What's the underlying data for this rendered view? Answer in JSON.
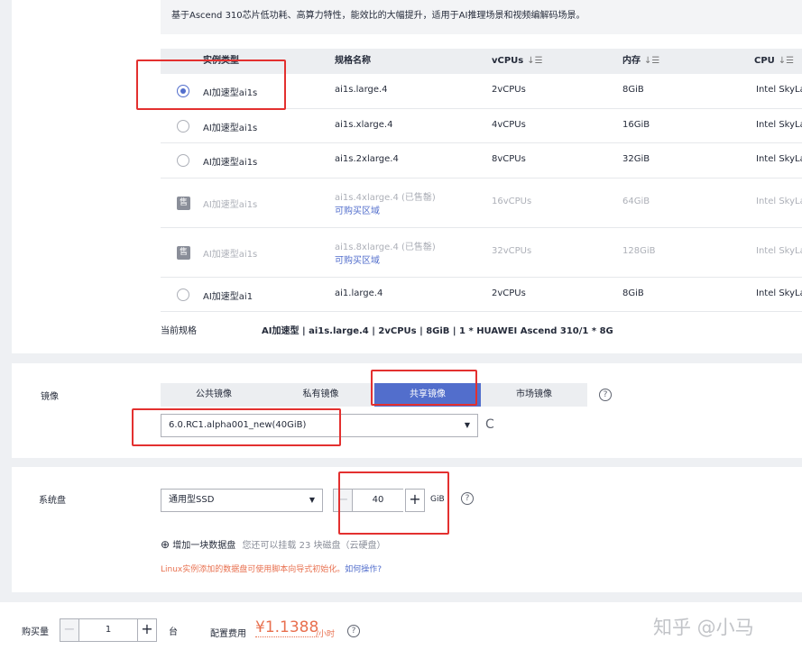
{
  "description": "基于Ascend 310芯片低功耗、高算力特性，能效比的大幅提升，适用于AI推理场景和视频编解码场景。",
  "table": {
    "headers": {
      "type": "实例类型",
      "spec": "规格名称",
      "vcpus": "vCPUs",
      "memory": "内存",
      "cpu": "CPU"
    },
    "sort_icon": "↓☰",
    "rows": [
      {
        "state": "selected",
        "type": "AI加速型ai1s",
        "spec": "ai1s.large.4",
        "spec_note": "",
        "vcpus": "2vCPUs",
        "memory": "8GiB",
        "cpu": "Intel SkyLa"
      },
      {
        "state": "normal",
        "type": "AI加速型ai1s",
        "spec": "ai1s.xlarge.4",
        "spec_note": "",
        "vcpus": "4vCPUs",
        "memory": "16GiB",
        "cpu": "Intel SkyLa"
      },
      {
        "state": "normal",
        "type": "AI加速型ai1s",
        "spec": "ai1s.2xlarge.4",
        "spec_note": "",
        "vcpus": "8vCPUs",
        "memory": "32GiB",
        "cpu": "Intel SkyLa"
      },
      {
        "state": "soldout",
        "type": "AI加速型ai1s",
        "spec": "ai1s.4xlarge.4 (已售罄)",
        "spec_note": "可购买区域",
        "vcpus": "16vCPUs",
        "memory": "64GiB",
        "cpu": "Intel SkyLa"
      },
      {
        "state": "soldout",
        "type": "AI加速型ai1s",
        "spec": "ai1s.8xlarge.4 (已售罄)",
        "spec_note": "可购买区域",
        "vcpus": "32vCPUs",
        "memory": "128GiB",
        "cpu": "Intel SkyLa"
      },
      {
        "state": "normal",
        "type": "AI加速型ai1",
        "spec": "ai1.large.4",
        "spec_note": "",
        "vcpus": "2vCPUs",
        "memory": "8GiB",
        "cpu": "Intel SkyLa"
      }
    ],
    "soldout_glyph": "售"
  },
  "current_spec": {
    "label": "当前规格",
    "value": "AI加速型 | ai1s.large.4 | 2vCPUs | 8GiB | 1 * HUAWEI Ascend 310/1 * 8G"
  },
  "image": {
    "label": "镜像",
    "tabs": [
      {
        "label": "公共镜像",
        "active": false
      },
      {
        "label": "私有镜像",
        "active": false
      },
      {
        "label": "共享镜像",
        "active": true
      },
      {
        "label": "市场镜像",
        "active": false
      }
    ],
    "selected_image": "6.0.RC1.alpha001_new(40GiB)",
    "help": "?",
    "refresh": "C",
    "caret": "▼"
  },
  "system_disk": {
    "label": "系统盘",
    "type": "通用型SSD",
    "caret": "▼",
    "minus": "−",
    "size": "40",
    "plus": "+",
    "unit": "GiB",
    "help": "?",
    "add_icon": "⊕",
    "add_label": "增加一块数据盘",
    "add_hint": "您还可以挂载 23 块磁盘（云硬盘）",
    "linux_hint": "Linux实例添加的数据盘可使用脚本向导式初始化。",
    "how_link": "如何操作?"
  },
  "footer": {
    "quantity_label": "购买量",
    "minus": "−",
    "quantity": "1",
    "plus": "+",
    "unit": "台",
    "fee_label": "配置费用",
    "price": "¥1.1388",
    "price_unit": "/小时",
    "help": "?",
    "watermark": "知乎 @小马"
  },
  "colors": {
    "accent": "#526ecc",
    "price": "#e8704f",
    "highlight": "#e3302f",
    "hint": "#e8704f"
  }
}
